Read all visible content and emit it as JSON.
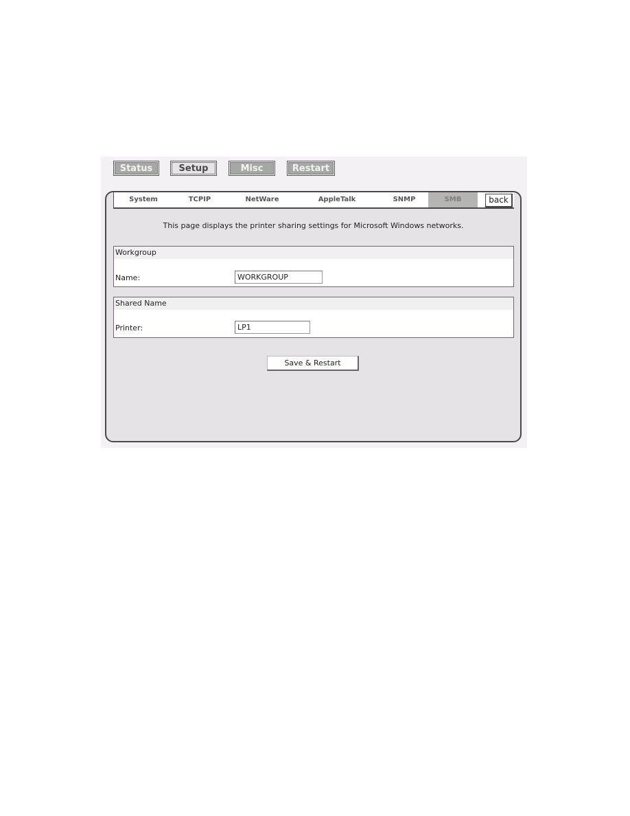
{
  "top_nav": [
    {
      "label": "Status",
      "active": false
    },
    {
      "label": "Setup",
      "active": true
    },
    {
      "label": "Misc",
      "active": false
    },
    {
      "label": "Restart",
      "active": false
    }
  ],
  "sub_nav": [
    {
      "label": "System",
      "active": false
    },
    {
      "label": "TCPIP",
      "active": false
    },
    {
      "label": "NetWare",
      "active": false
    },
    {
      "label": "AppleTalk",
      "active": false
    },
    {
      "label": "SNMP",
      "active": false
    },
    {
      "label": "SMB",
      "active": true
    }
  ],
  "back_label": "back",
  "description": "This page displays the printer sharing settings for Microsoft Windows networks.",
  "workgroup": {
    "title": "Workgroup",
    "name_label": "Name:",
    "name_value": "WORKGROUP"
  },
  "shared_name": {
    "title": "Shared Name",
    "printer_label": "Printer:",
    "printer_value": "LP1"
  },
  "save_label": "Save & Restart"
}
